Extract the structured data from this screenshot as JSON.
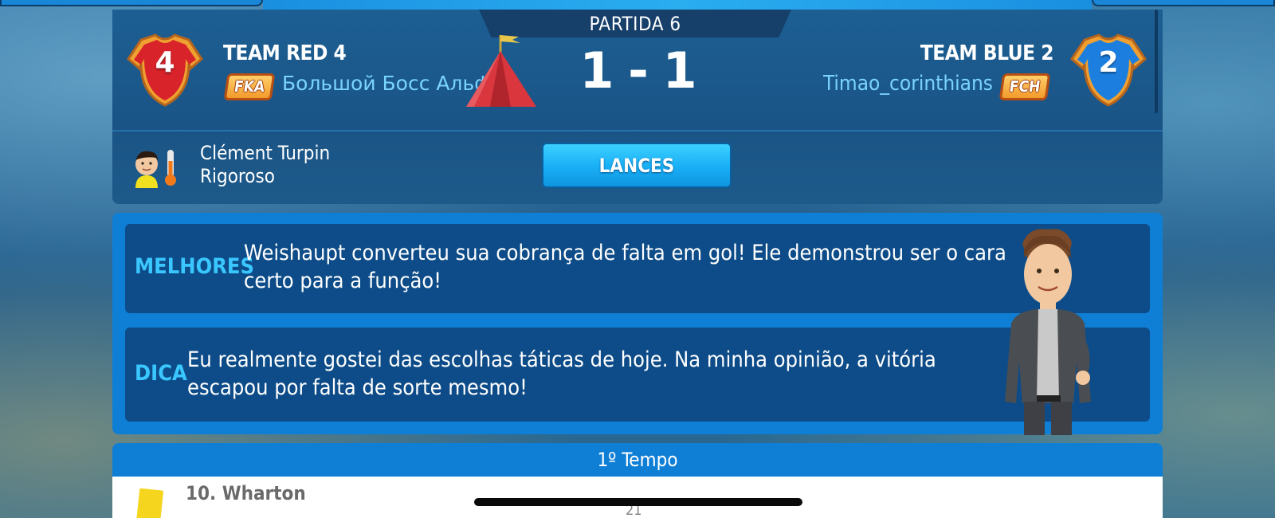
{
  "match": {
    "round_label": "PARTIDA 6",
    "score": "1 - 1",
    "home": {
      "shirt_number": "4",
      "team_name": "TEAM RED 4",
      "club_tag": "FKA",
      "manager": "Большой Босс Альфа",
      "shirt_color": "#d8232a"
    },
    "away": {
      "shirt_number": "2",
      "team_name": "TEAM BLUE 2",
      "club_tag": "FCH",
      "manager": "Timao_corinthians",
      "shirt_color": "#1c7fe0"
    },
    "referee": {
      "name": "Clément Turpin",
      "style": "Rigoroso"
    },
    "lances_button": "LANCES"
  },
  "tips": {
    "best": {
      "label": "MELHORES",
      "text": "Weishaupt converteu sua cobrança de falta em gol! Ele demonstrou ser o cara certo para a função!"
    },
    "tip": {
      "label": "DICA",
      "text": "Eu realmente gostei das escolhas táticas de hoje. Na minha opinião, a vitória escapou por falta de sorte mesmo!"
    }
  },
  "events": {
    "period_label": "1º Tempo",
    "items": [
      {
        "player": "10. Wharton",
        "card": "yellow-card-icon"
      }
    ],
    "page_number": "21"
  },
  "colors": {
    "accent": "#0f7fd6",
    "panel_dark": "#0d4c88",
    "label_cyan": "#3ac7ff",
    "manager_text": "#7ad3ff"
  }
}
